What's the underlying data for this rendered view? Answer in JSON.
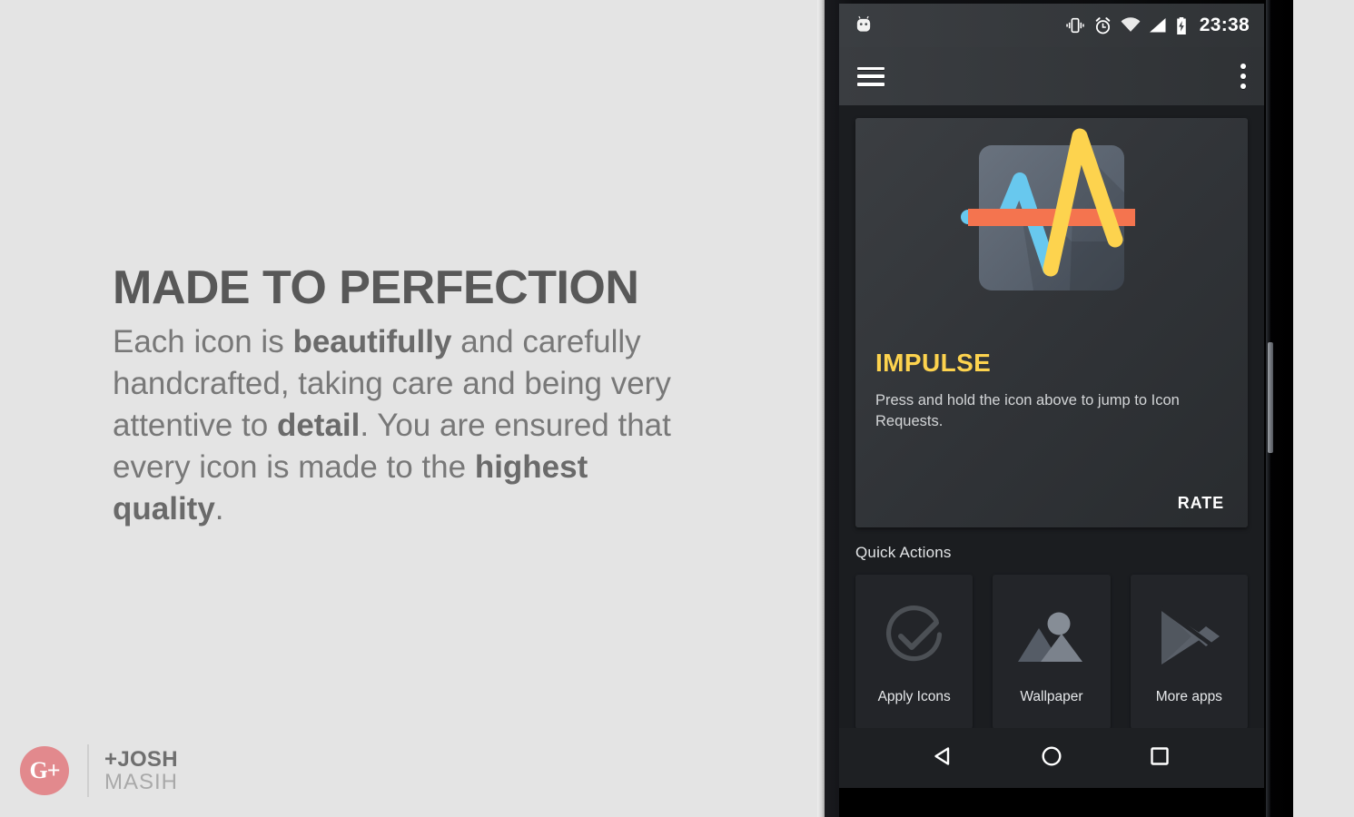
{
  "promo": {
    "headline": "MADE TO PERFECTION",
    "body_html": "Each icon is <b>beautifully</b> and carefully handcrafted, taking care and being very attentive to <b>detail</b>. You are ensured that every icon is made to the <b>highest quality</b>.",
    "headline_color": "#585858",
    "body_color": "#787878",
    "background_color": "#e4e4e4"
  },
  "credit": {
    "badge_glyph": "G+",
    "badge_icon": "google-plus-icon",
    "badge_color": "#e2898d",
    "first_line": "+JOSH",
    "second_line": "MASIH"
  },
  "phone": {
    "status_bar": {
      "notification_icon": "android-mascot-icon",
      "icons": [
        "vibrate-icon",
        "alarm-icon",
        "wifi-icon",
        "cellular-signal-icon",
        "battery-charging-icon"
      ],
      "clock": "23:38"
    },
    "toolbar": {
      "menu_icon": "hamburger-menu-icon",
      "overflow_icon": "overflow-menu-icon"
    },
    "hero_card": {
      "app_icon_name": "impulse-waveform-icon",
      "app_title": "IMPULSE",
      "app_title_color": "#fdd34e",
      "description": "Press and hold the icon above to jump to Icon Requests.",
      "rate_label": "RATE",
      "icon_colors": {
        "plate": "#5b6470",
        "blue_wave": "#68c8ee",
        "orange_bar": "#f4744f",
        "yellow_wave": "#fdd34e"
      }
    },
    "quick_actions": {
      "section_label": "Quick Actions",
      "items": [
        {
          "label": "Apply Icons",
          "icon": "check-circle-icon"
        },
        {
          "label": "Wallpaper",
          "icon": "image-mountains-icon"
        },
        {
          "label": "More apps",
          "icon": "google-play-icon"
        }
      ]
    },
    "nav_bar": {
      "items": [
        {
          "name": "back-button",
          "icon": "triangle-back-icon"
        },
        {
          "name": "home-button",
          "icon": "circle-home-icon"
        },
        {
          "name": "recents-button",
          "icon": "square-recents-icon"
        }
      ]
    },
    "screen_background": "#1b1d20"
  }
}
